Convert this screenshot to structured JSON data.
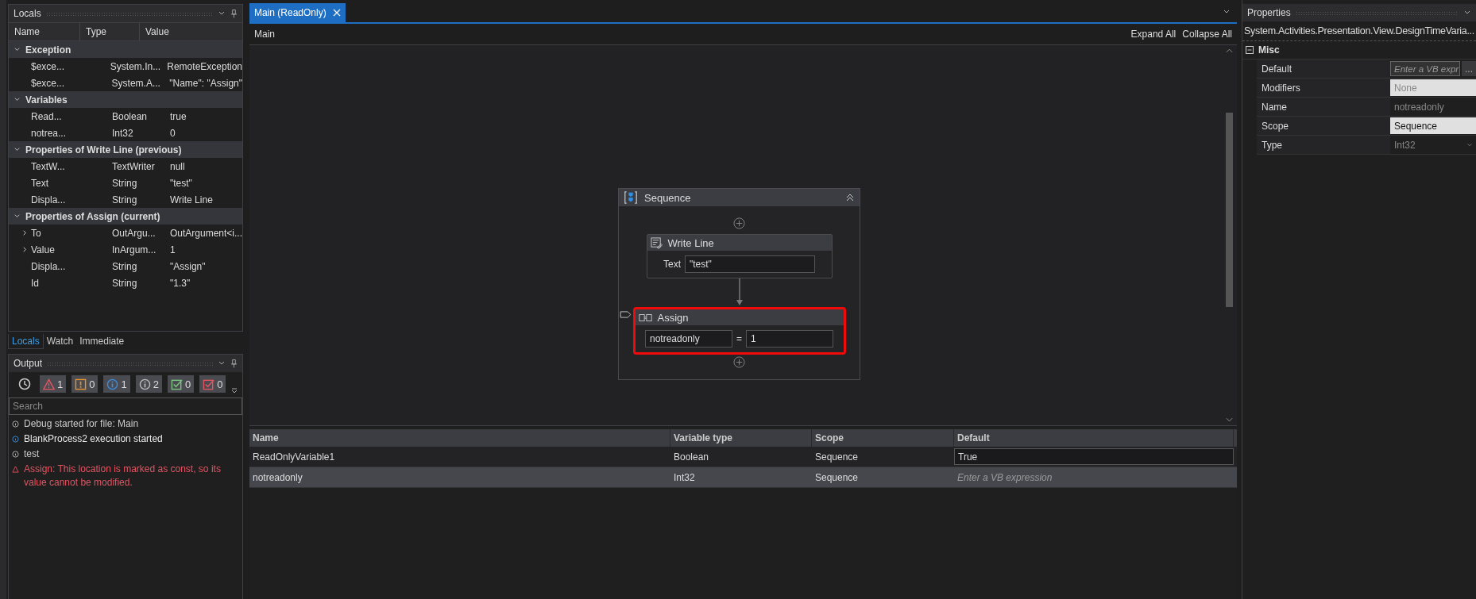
{
  "locals": {
    "title": "Locals",
    "columns": [
      "Name",
      "Type",
      "Value"
    ],
    "groups": [
      {
        "label": "Exception",
        "expanded": true,
        "rows": [
          {
            "name": "$exce...",
            "type": "System.In...",
            "value": "RemoteException",
            "expandable": false
          },
          {
            "name": "$exce...",
            "type": "System.A...",
            "value": " \"Name\": \"Assign\"",
            "expandable": false
          }
        ]
      },
      {
        "label": "Variables",
        "expanded": true,
        "rows": [
          {
            "name": "Read...",
            "type": "Boolean",
            "value": "true",
            "expandable": false
          },
          {
            "name": "notrea...",
            "type": "Int32",
            "value": "0",
            "expandable": false
          }
        ]
      },
      {
        "label": "Properties of Write Line (previous)",
        "expanded": true,
        "rows": [
          {
            "name": "TextW...",
            "type": "TextWriter",
            "value": "null",
            "expandable": false
          },
          {
            "name": "Text",
            "type": "String",
            "value": "\"test\"",
            "expandable": false
          },
          {
            "name": "Displa...",
            "type": "String",
            "value": "Write Line",
            "expandable": false
          }
        ]
      },
      {
        "label": "Properties of Assign (current)",
        "expanded": true,
        "rows": [
          {
            "name": "To",
            "type": "OutArgu...",
            "value": "OutArgument<i...",
            "expandable": true
          },
          {
            "name": "Value",
            "type": "InArgum...",
            "value": "1",
            "expandable": true
          },
          {
            "name": "Displa...",
            "type": "String",
            "value": "\"Assign\"",
            "expandable": false
          },
          {
            "name": "Id",
            "type": "String",
            "value": "\"1.3\"",
            "expandable": false
          }
        ]
      }
    ]
  },
  "debug_tabs": [
    {
      "label": "Locals",
      "selected": true
    },
    {
      "label": "Watch",
      "selected": false
    },
    {
      "label": "Immediate",
      "selected": false
    }
  ],
  "output": {
    "title": "Output",
    "filters": [
      {
        "kind": "error",
        "count": "1"
      },
      {
        "kind": "warning",
        "count": "0"
      },
      {
        "kind": "info",
        "count": "1"
      },
      {
        "kind": "trace",
        "count": "2"
      },
      {
        "kind": "success",
        "count": "0"
      },
      {
        "kind": "failure",
        "count": "0"
      }
    ],
    "search": {
      "placeholder": "Search"
    },
    "messages": [
      {
        "kind": "trace",
        "text": "Debug started for file: Main"
      },
      {
        "kind": "info",
        "text": "BlankProcess2 execution started"
      },
      {
        "kind": "trace",
        "text": "test"
      },
      {
        "kind": "error",
        "text": "Assign: This location is marked as const, so its value cannot be modified."
      }
    ]
  },
  "document_tabs": [
    {
      "label": "Main (ReadOnly)",
      "selected": true
    }
  ],
  "designer": {
    "breadcrumb": "Main",
    "expand_all": "Expand All",
    "collapse_all": "Collapse All",
    "sequence": {
      "title": "Sequence",
      "activities": [
        {
          "kind": "write_line",
          "title": "Write Line",
          "label": "Text",
          "value": "\"test\"",
          "error": false
        },
        {
          "kind": "assign",
          "title": "Assign",
          "to": "notreadonly",
          "operator": "=",
          "value": "1",
          "error": true
        }
      ]
    }
  },
  "variables": {
    "columns": [
      "Name",
      "Variable type",
      "Scope",
      "Default"
    ],
    "rows": [
      {
        "name": "ReadOnlyVariable1",
        "type": "Boolean",
        "scope": "Sequence",
        "default": "True",
        "selected": false
      },
      {
        "name": "notreadonly",
        "type": "Int32",
        "scope": "Sequence",
        "placeholder": "Enter a VB expression",
        "selected": true
      }
    ]
  },
  "properties": {
    "title": "Properties",
    "type_name": "System.Activities.Presentation.View.DesignTimeVaria...",
    "category": {
      "label": "Misc",
      "expanded": true
    },
    "rows": [
      {
        "name": "Default",
        "kind": "expression",
        "placeholder": "Enter a VB expr",
        "button": "..."
      },
      {
        "name": "Modifiers",
        "kind": "combo",
        "value": "None",
        "disabled": true
      },
      {
        "name": "Name",
        "kind": "text",
        "value": "notreadonly",
        "disabled": true
      },
      {
        "name": "Scope",
        "kind": "combo",
        "value": "Sequence",
        "disabled": false
      },
      {
        "name": "Type",
        "kind": "type",
        "value": "Int32",
        "disabled": true
      }
    ]
  }
}
